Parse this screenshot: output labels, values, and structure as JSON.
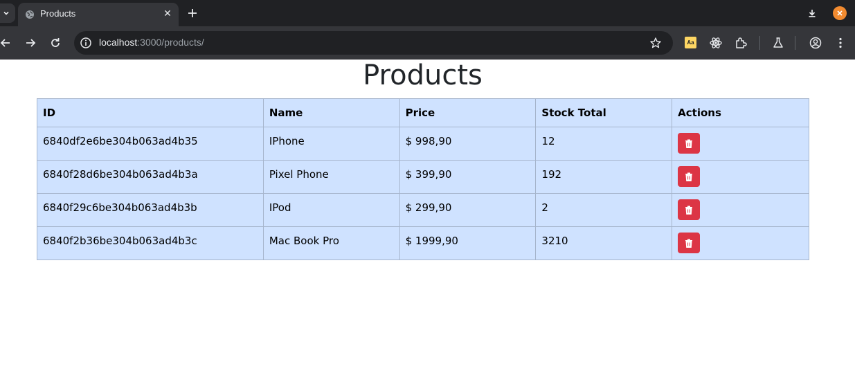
{
  "browser": {
    "tab_title": "Products",
    "tab_close": "✕",
    "url_host": "localhost",
    "url_rest": ":3000/products/",
    "extension_label": "Aa",
    "accent_color": "#f28b30"
  },
  "page": {
    "title": "Products"
  },
  "table": {
    "headers": [
      "ID",
      "Name",
      "Price",
      "Stock Total",
      "Actions"
    ],
    "rows": [
      {
        "id": "6840df2e6be304b063ad4b35",
        "name": "IPhone",
        "price": "$ 998,90",
        "stock": "12"
      },
      {
        "id": "6840f28d6be304b063ad4b3a",
        "name": "Pixel Phone",
        "price": "$ 399,90",
        "stock": "192"
      },
      {
        "id": "6840f29c6be304b063ad4b3b",
        "name": "IPod",
        "price": "$ 299,90",
        "stock": "2"
      },
      {
        "id": "6840f2b36be304b063ad4b3c",
        "name": "Mac Book Pro",
        "price": "$ 1999,90",
        "stock": "3210"
      }
    ],
    "row_background": "#cfe2ff",
    "delete_button_color": "#dc3545",
    "delete_icon": "trash-icon"
  }
}
